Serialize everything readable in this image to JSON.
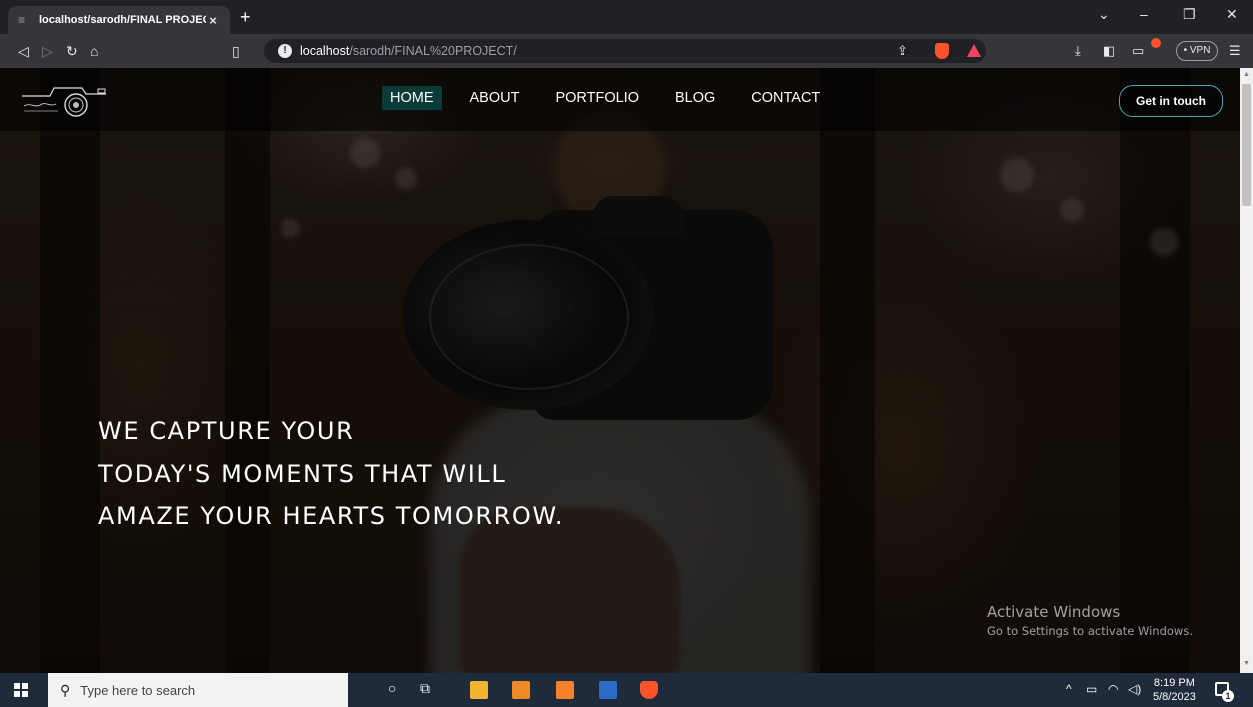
{
  "browser": {
    "tab_title": "localhost/sarodh/FINAL PROJECT",
    "tab_close": "×",
    "new_tab": "+",
    "url_host": "localhost",
    "url_path": "/sarodh/FINAL%20PROJECT/",
    "vpn_label": "• VPN",
    "icons": [
      "back-icon",
      "forward-icon",
      "reload-icon",
      "home-icon",
      "bookmark-icon",
      "site-info-icon",
      "share-icon",
      "brave-shield-icon",
      "brave-rewards-icon",
      "downloads-icon",
      "sidebar-icon",
      "wallet-icon",
      "menu-icon"
    ]
  },
  "site": {
    "nav": [
      "HOME",
      "ABOUT",
      "PORTFOLIO",
      "BLOG",
      "CONTACT"
    ],
    "active_nav": "HOME",
    "cta_label": "Get in touch",
    "headline": [
      "WE CAPTURE YOUR",
      "TODAY'S MOMENTS THAT WILL",
      "AMAZE YOUR HEARTS TOMORROW."
    ],
    "colors": {
      "active_nav_bg": "#0b3b37",
      "cta_border": "#4aa6b6"
    }
  },
  "watermark": {
    "title": "Activate Windows",
    "subtitle": "Go to Settings to activate Windows."
  },
  "taskbar": {
    "search_placeholder": "Type here to search",
    "time": "8:19 PM",
    "date": "5/8/2023",
    "notification_count": "1"
  }
}
